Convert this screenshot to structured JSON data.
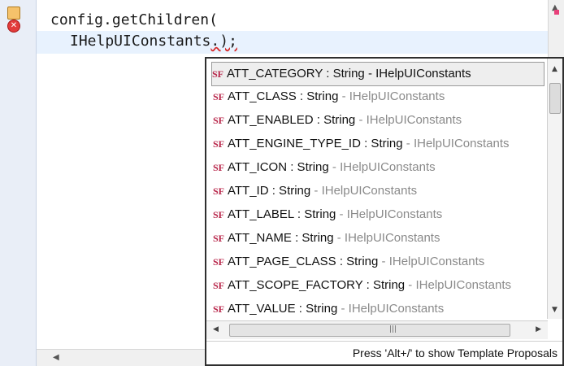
{
  "editor": {
    "line1": "config.getChildren(",
    "line2_prefix": "IHelpUIConstants",
    "line2_suffix": ".);",
    "markers": {
      "warning": "warning-marker",
      "error": "✕"
    }
  },
  "popup": {
    "items": [
      {
        "icon": "SF",
        "name": "ATT_CATEGORY : String",
        "owner": " - IHelpUIConstants"
      },
      {
        "icon": "SF",
        "name": "ATT_CLASS : String",
        "owner": " - IHelpUIConstants"
      },
      {
        "icon": "SF",
        "name": "ATT_ENABLED : String",
        "owner": " - IHelpUIConstants"
      },
      {
        "icon": "SF",
        "name": "ATT_ENGINE_TYPE_ID : String",
        "owner": " - IHelpUIConstants"
      },
      {
        "icon": "SF",
        "name": "ATT_ICON : String",
        "owner": " - IHelpUIConstants"
      },
      {
        "icon": "SF",
        "name": "ATT_ID : String",
        "owner": " - IHelpUIConstants"
      },
      {
        "icon": "SF",
        "name": "ATT_LABEL : String",
        "owner": " - IHelpUIConstants"
      },
      {
        "icon": "SF",
        "name": "ATT_NAME : String",
        "owner": " - IHelpUIConstants"
      },
      {
        "icon": "SF",
        "name": "ATT_PAGE_CLASS : String",
        "owner": " - IHelpUIConstants"
      },
      {
        "icon": "SF",
        "name": "ATT_SCOPE_FACTORY : String",
        "owner": " - IHelpUIConstants"
      },
      {
        "icon": "SF",
        "name": "ATT_VALUE : String",
        "owner": " - IHelpUIConstants"
      }
    ],
    "status": "Press 'Alt+/' to show Template Proposals",
    "icons": {
      "field": "static-field-icon"
    }
  }
}
